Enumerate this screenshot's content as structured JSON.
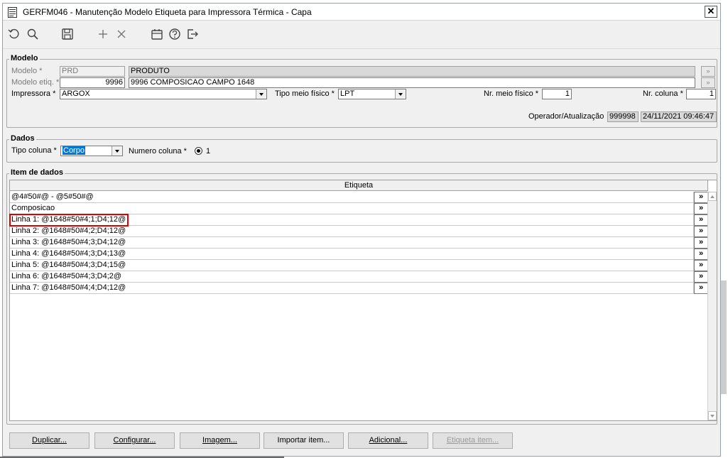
{
  "window": {
    "title": "GERFM046 - Manutenção Modelo Etiqueta para Impressora Térmica - Capa",
    "close_label": "✕"
  },
  "toolbar": {
    "icons": [
      "undo-icon",
      "search-icon",
      "save-icon",
      "add-icon",
      "delete-icon",
      "calendar-icon",
      "help-icon",
      "exit-icon"
    ]
  },
  "modelo": {
    "group_label": "Modelo",
    "modelo_label": "Modelo *",
    "modelo_code": "PRD",
    "modelo_desc": "PRODUTO",
    "modelo_etiq_label": "Modelo etiq. *",
    "modelo_etiq_code": "9996",
    "modelo_etiq_desc": "9996 COMPOSICAO CAMPO 1648",
    "impressora_label": "Impressora *",
    "impressora_value": "ARGOX",
    "tipo_meio_label": "Tipo meio físico *",
    "tipo_meio_value": "LPT",
    "nr_meio_label": "Nr. meio físico *",
    "nr_meio_value": "1",
    "nr_coluna_label": "Nr. coluna *",
    "nr_coluna_value": "1",
    "operador_label": "Operador/Atualização",
    "operador_value": "999998",
    "atualizacao_value": "24/11/2021 09:46:47",
    "lookup_glyph": "»"
  },
  "dados": {
    "group_label": "Dados",
    "tipo_coluna_label": "Tipo coluna *",
    "tipo_coluna_value": "Corpo",
    "numero_coluna_label": "Numero coluna *",
    "numero_coluna_value": "1"
  },
  "item_dados": {
    "group_label": "Item de dados",
    "column_header": "Etiqueta",
    "row_button_label": "»",
    "rows": [
      "@4#50#@ - @5#50#@",
      "Composicao",
      "Linha 1: @1648#50#4;1;D4;12@",
      "Linha 2: @1648#50#4;2;D4;12@",
      "Linha 3: @1648#50#4;3;D4;12@",
      "Linha 4: @1648#50#4;3;D4;13@",
      "Linha 5: @1648#50#4;3;D4;15@",
      "Linha 6: @1648#50#4;3;D4;2@",
      "Linha 7: @1648#50#4;4;D4;12@"
    ]
  },
  "buttons": {
    "duplicar": "Duplicar...",
    "configurar": "Configurar...",
    "imagem": "Imagem...",
    "importar": "Importar item...",
    "adicional": "Adicional...",
    "etiqueta_item": "Etiqueta item..."
  },
  "colors": {
    "selection": "#0078d7",
    "highlight_border": "#e00000"
  }
}
